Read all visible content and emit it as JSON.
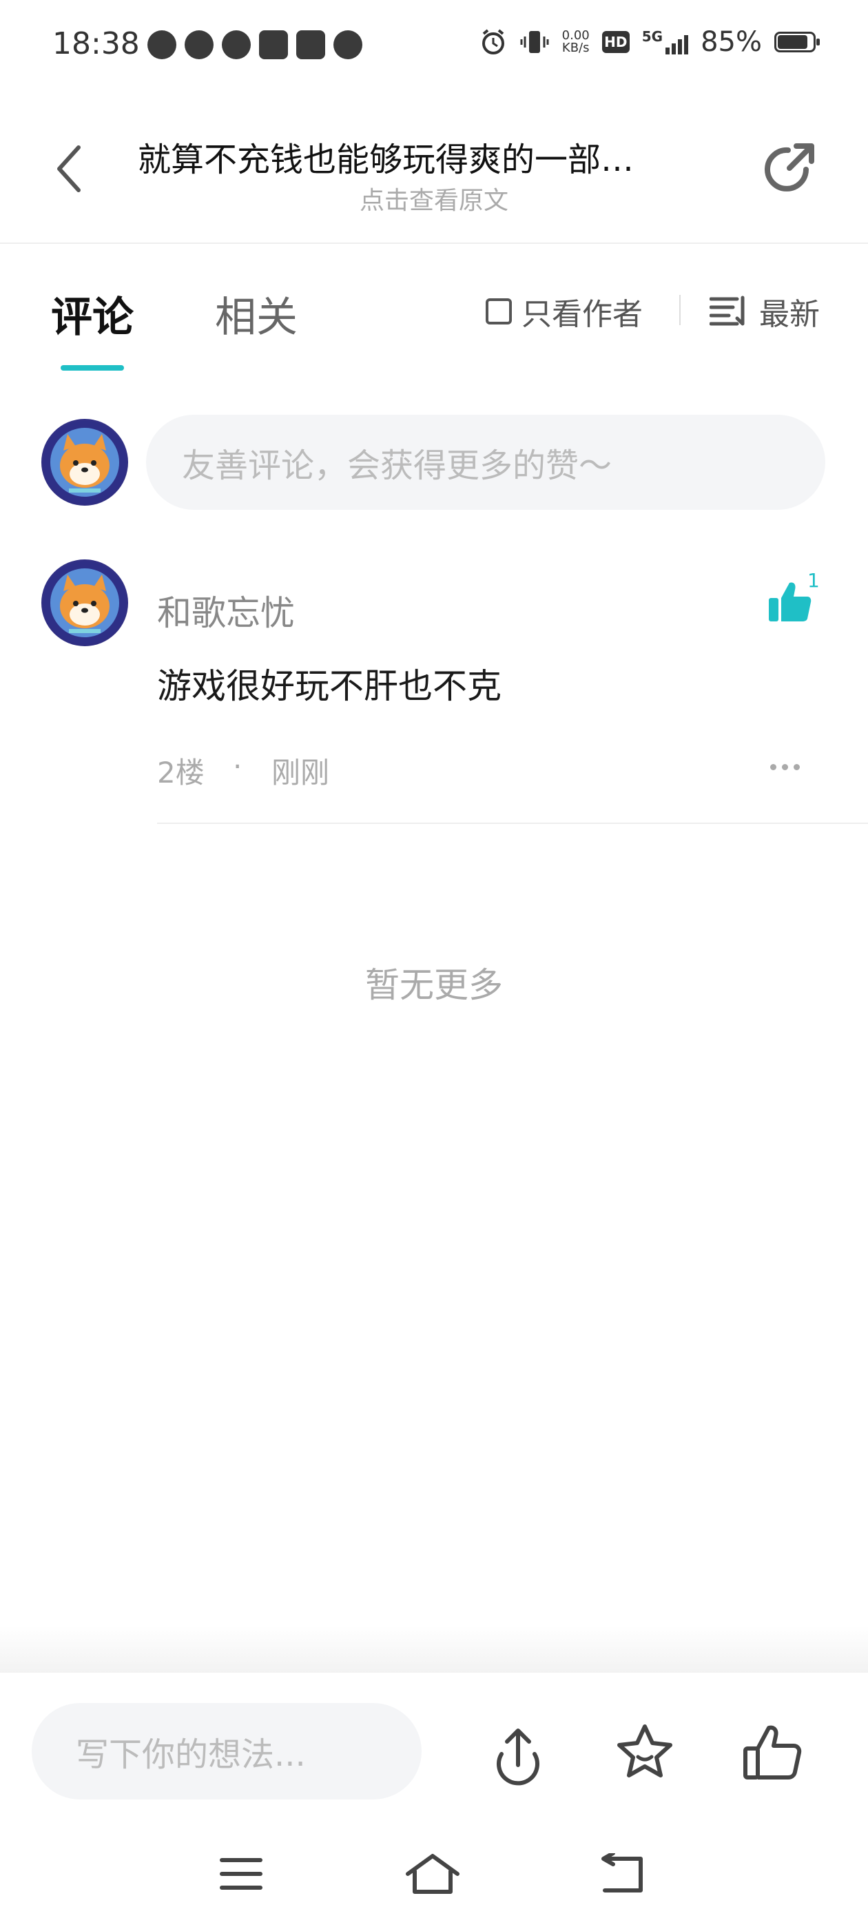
{
  "status_bar": {
    "time": "18:38",
    "net_speed_value": "0.00",
    "net_speed_unit": "KB/s",
    "hd_label": "HD",
    "network_label": "5G",
    "battery_percent": "85%",
    "battery_level": 0.85,
    "left_icons": [
      "message-icon",
      "app-icon",
      "game-icon",
      "crown-icon",
      "k-app-icon",
      "app-icon-2"
    ]
  },
  "header": {
    "title": "就算不充钱也能够玩得爽的一部…",
    "subtitle": "点击查看原文"
  },
  "tabs": {
    "comments": "评论",
    "related": "相关",
    "author_only": "只看作者",
    "sort": "最新"
  },
  "comment_input": {
    "placeholder": "友善评论，会获得更多的赞～"
  },
  "comments": [
    {
      "username": "和歌忘忧",
      "text": "游戏很好玩不肝也不克",
      "floor": "2楼",
      "separator": "·",
      "time": "刚刚",
      "likes": "1"
    }
  ],
  "list_end": "暂无更多",
  "bottom_bar": {
    "write_placeholder": "写下你的想法..."
  },
  "colors": {
    "accent": "#1fbfc6",
    "muted_text": "#aaaaaa",
    "input_bg": "#f4f5f7"
  }
}
